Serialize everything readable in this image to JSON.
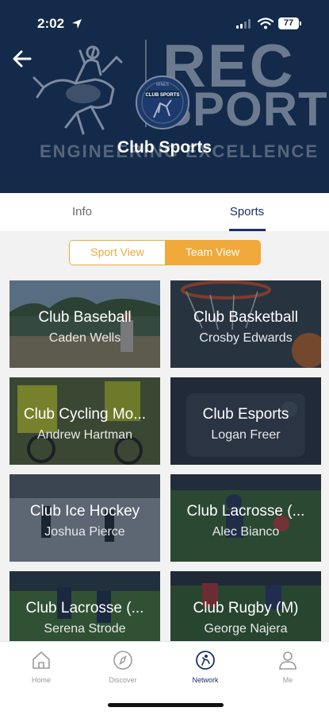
{
  "status_bar": {
    "time": "2:02",
    "battery": "77"
  },
  "header": {
    "title": "Club Sports",
    "banner_rec": "REC",
    "banner_sports": "SPORTS",
    "banner_motto": "ENGINEERING EXCELLENCE",
    "logo_text": "CLUB SPORTS",
    "logo_caption": "MINES"
  },
  "tabs": [
    {
      "label": "Info",
      "active": false
    },
    {
      "label": "Sports",
      "active": true
    }
  ],
  "view_toggle": {
    "left": "Sport View",
    "right": "Team View",
    "selected": "Team View"
  },
  "cards": [
    {
      "title": "Club Baseball",
      "subtitle": "Caden Wells"
    },
    {
      "title": "Club Basketball",
      "subtitle": "Crosby Edwards"
    },
    {
      "title": "Club Cycling Mo...",
      "subtitle": "Andrew Hartman"
    },
    {
      "title": "Club Esports",
      "subtitle": "Logan Freer"
    },
    {
      "title": "Club Ice Hockey",
      "subtitle": "Joshua Pierce"
    },
    {
      "title": "Club Lacrosse (...",
      "subtitle": "Alec Bianco"
    },
    {
      "title": "Club Lacrosse (...",
      "subtitle": "Serena Strode"
    },
    {
      "title": "Club Rugby (M)",
      "subtitle": "George Najera"
    }
  ],
  "bottom_nav": [
    {
      "label": "Home",
      "icon": "home-icon",
      "active": false
    },
    {
      "label": "Discover",
      "icon": "compass-icon",
      "active": false
    },
    {
      "label": "Network",
      "icon": "network-icon",
      "active": true
    },
    {
      "label": "Me",
      "icon": "person-icon",
      "active": false
    }
  ],
  "colors": {
    "header_bg": "#132a4a",
    "accent": "#f0a93a",
    "active_nav": "#1c2f6b"
  }
}
